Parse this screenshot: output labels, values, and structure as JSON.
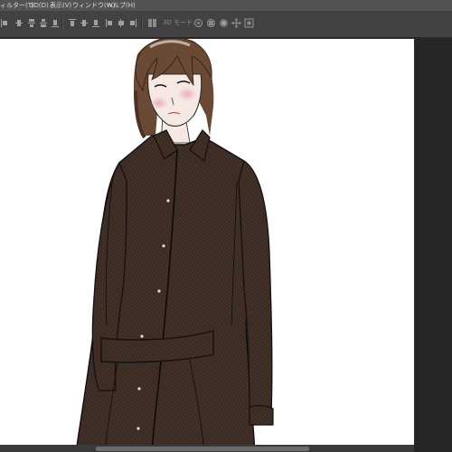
{
  "menu": {
    "filter": "ィルター(T)",
    "three_d": "3D(D)",
    "view": "表示(V)",
    "window": "ウィンドウ(W)",
    "help": "ヘルプ(H)"
  },
  "options_bar": {
    "mode_3d_label": "3D モード:",
    "icons": [
      "align-left-edges-icon",
      "align-horizontal-centers-icon",
      "align-right-edges-icon",
      "align-top-edges-icon",
      "align-vertical-centers-icon",
      "align-bottom-edges-icon",
      "distribute-top-icon",
      "distribute-vertical-centers-icon",
      "distribute-bottom-icon",
      "distribute-left-icon",
      "distribute-horizontal-centers-icon",
      "distribute-right-icon",
      "auto-align-layers-icon",
      "orbit-3d-icon",
      "roll-3d-icon",
      "drag-3d-icon",
      "slide-3d-icon",
      "scale-3d-icon"
    ]
  },
  "colors": {
    "menubar_bg": "#535353",
    "options_bg": "#424242",
    "workspace_bg": "#282828",
    "canvas_bg": "#ffffff",
    "coat": "#3a2a22",
    "hair": "#6b4a35",
    "skin": "#f6e8e2",
    "cheek": "#e8a7b8"
  },
  "canvas": {
    "artwork": "illustration of a woman with shoulder-length brown hair wearing a long dark brown button-front shirt dress with a belt"
  }
}
